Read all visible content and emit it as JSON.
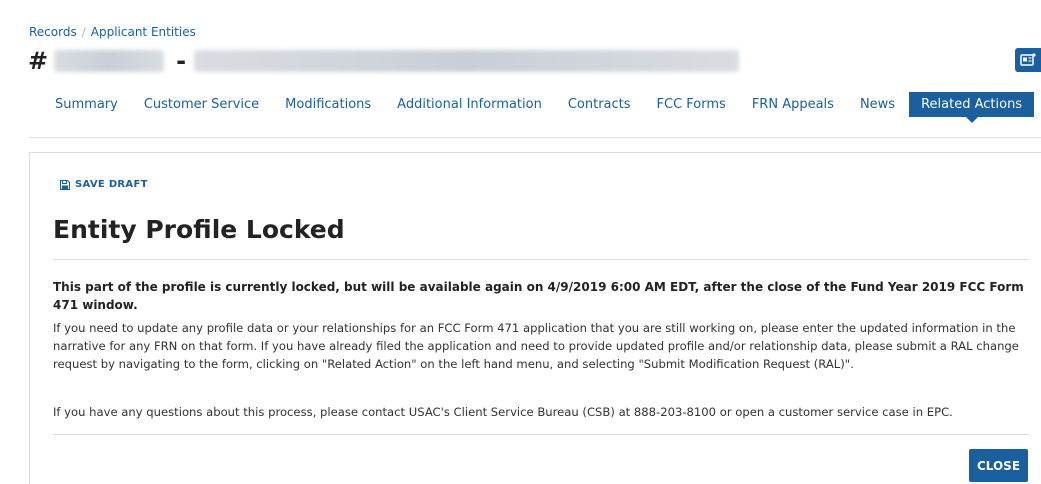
{
  "breadcrumb": {
    "items": [
      "Records",
      "Applicant Entities"
    ],
    "separator": "/"
  },
  "entity": {
    "hash": "#",
    "dash": "-"
  },
  "tabs": [
    {
      "label": "Summary"
    },
    {
      "label": "Customer Service"
    },
    {
      "label": "Modifications"
    },
    {
      "label": "Additional Information"
    },
    {
      "label": "Contracts"
    },
    {
      "label": "FCC Forms"
    },
    {
      "label": "FRN Appeals"
    },
    {
      "label": "News"
    },
    {
      "label": "Related Actions"
    }
  ],
  "active_tab": "Related Actions",
  "modal": {
    "save_draft": "SAVE DRAFT",
    "title": "Entity Profile Locked",
    "bold_message": "This part of the profile is currently locked, but will be available again on 4/9/2019 6:00 AM EDT, after the close of the Fund Year 2019 FCC Form 471 window.",
    "paragraph1": "If you need to update any profile data or your relationships for an FCC Form 471 application that you are still working on, please enter the updated information in the narrative for any FRN on that form. If you have already filed the application and need to provide updated profile and/or relationship data, please submit a RAL change request by navigating to the form, clicking on \"Related Action\" on the left hand menu, and selecting \"Submit Modification Request (RAL)\".",
    "paragraph2": "If you have any questions about this process, please contact USAC's Client Service Bureau (CSB) at 888-203-8100 or open a customer service case in EPC.",
    "close_label": "CLOSE"
  },
  "colors": {
    "accent": "#1a5f9e",
    "text": "#333333",
    "border": "#dcdcdc"
  },
  "icons": {
    "save": "floppy-disk-icon",
    "corner": "id-card-icon"
  }
}
